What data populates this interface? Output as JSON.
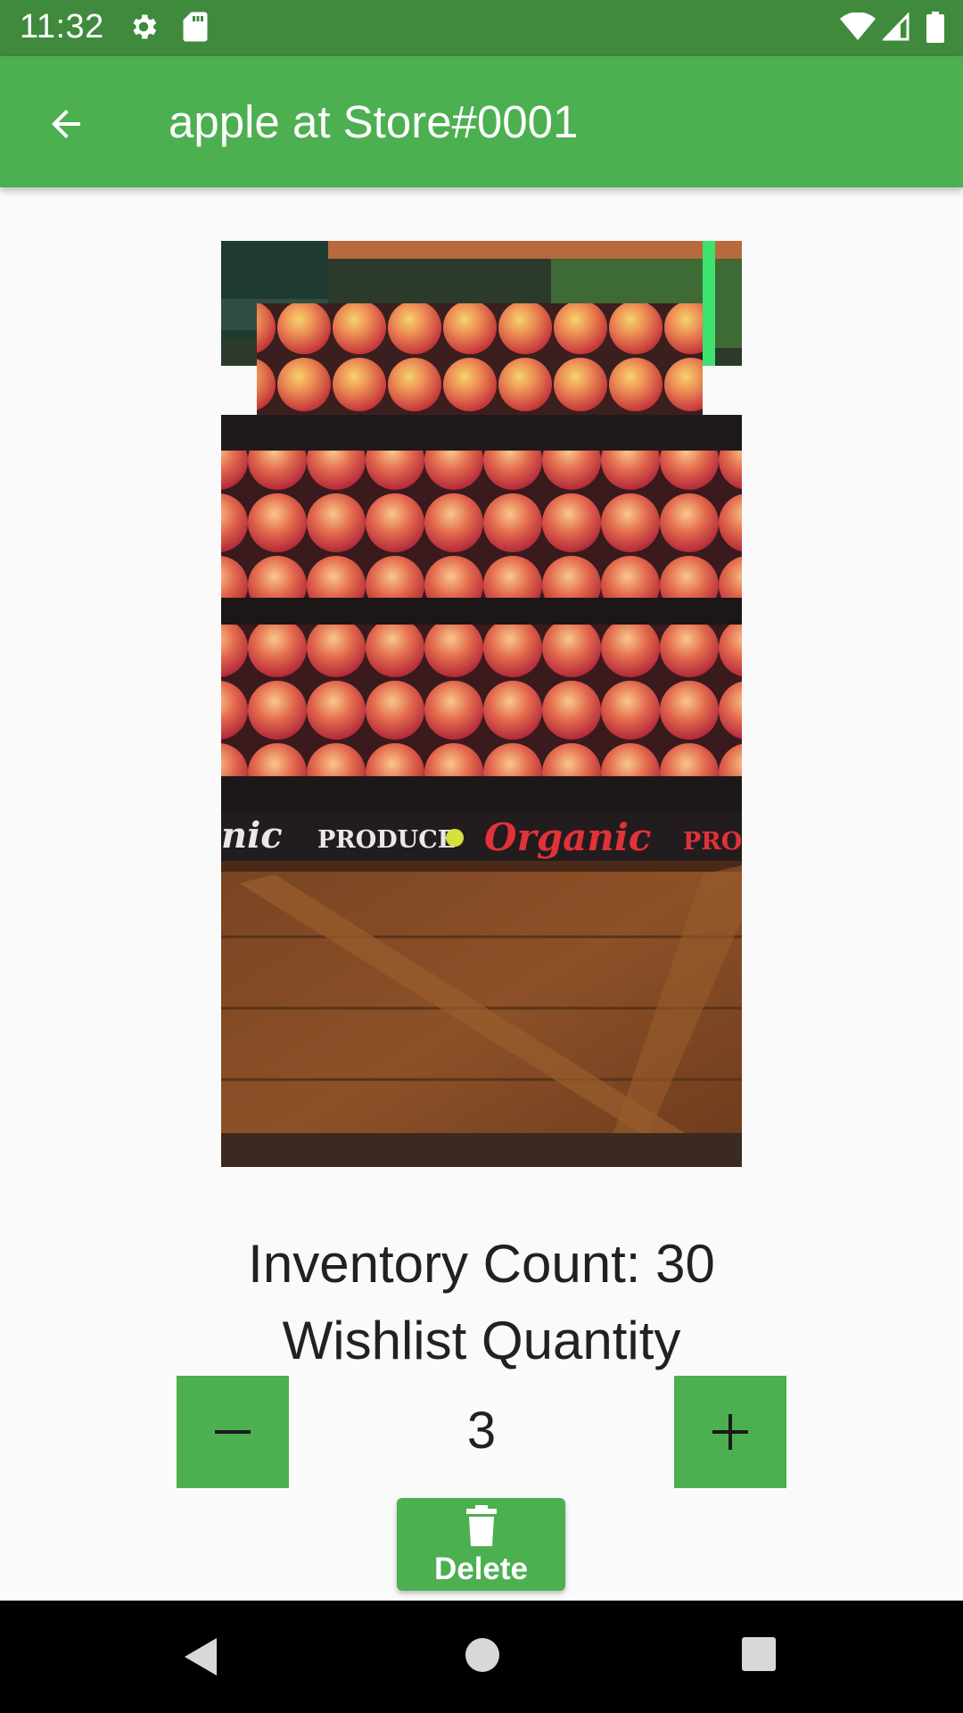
{
  "status_bar": {
    "time": "11:32",
    "icons": [
      "gear-icon",
      "sd-card-icon",
      "wifi-icon",
      "signal-icon",
      "battery-icon"
    ]
  },
  "app_bar": {
    "title": "apple at Store#0001",
    "back_icon": "arrow-back-icon"
  },
  "product": {
    "image": "apples-on-display-photo",
    "sign_text_left": "nic",
    "sign_text_mid": "PRODUCE",
    "sign_text_right": "Organic",
    "sign_text_cut": "PRO"
  },
  "inventory": {
    "count_label": "Inventory Count: 30",
    "wishlist_label": "Wishlist Quantity"
  },
  "quantity": {
    "value": "3",
    "decrement_icon": "minus-icon",
    "increment_icon": "plus-icon"
  },
  "delete_button": {
    "label": "Delete",
    "icon": "trash-icon"
  },
  "nav_bar": {
    "buttons": [
      "back-triangle-icon",
      "home-circle-icon",
      "recents-square-icon"
    ]
  },
  "colors": {
    "status_bar": "#3f8a3c",
    "app_bar": "#4caf50",
    "accent": "#4caf50",
    "background": "#fafafa",
    "nav_bar": "#000000"
  }
}
